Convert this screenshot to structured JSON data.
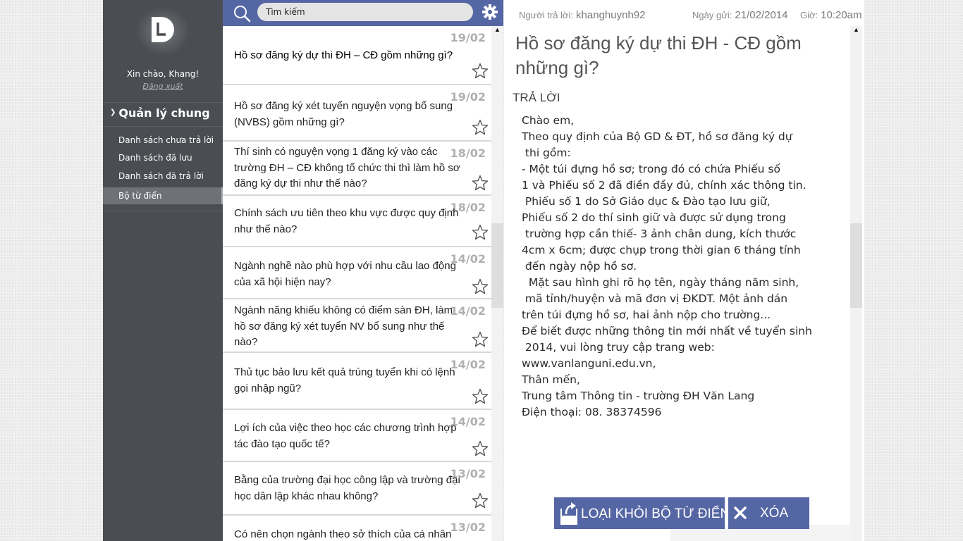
{
  "sidebar": {
    "greeting": "Xin chào, Khang!",
    "logout": "Đăng xuất",
    "section": "Quản lý chung",
    "items": [
      {
        "label": "Danh sách chưa trả lời"
      },
      {
        "label": "Danh sách đã lưu"
      },
      {
        "label": "Danh sách đã trả lời"
      },
      {
        "label": "Bộ từ điển",
        "active": true
      }
    ]
  },
  "search": {
    "value": "Tìm kiếm"
  },
  "questions": [
    {
      "date": "19/02",
      "text": "Hồ sơ đăng ký dự thi ĐH – CĐ gồm những gì?",
      "selected": true
    },
    {
      "date": "19/02",
      "text": "Hồ sơ đăng ký xét tuyển nguyện vọng bổ sung (NVBS) gồm những gì?"
    },
    {
      "date": "18/02",
      "text": "Thí sinh có nguyện vọng 1 đăng ký vào các trường ĐH – CĐ không tổ chức thi thì làm hồ sơ đăng ký dự thi như thế nào?"
    },
    {
      "date": "18/02",
      "text": "Chính sách ưu tiên theo khu vực được quy định như thế nào?"
    },
    {
      "date": "14/02",
      "text": "Ngành nghề nào phù hợp với nhu cầu lao động của xã hội hiện nay?"
    },
    {
      "date": "14/02",
      "text": "Ngành năng khiếu không có điểm sàn ĐH, làm hồ sơ đăng ký xét tuyển NV bổ sung như thế nào?"
    },
    {
      "date": "14/02",
      "text": "Thủ tục bảo lưu kết quả trúng tuyển khi có lệnh gọi nhập ngũ?"
    },
    {
      "date": "14/02",
      "text": "Lợi ích của việc theo học các chương trình hợp tác đào tạo quốc tế?"
    },
    {
      "date": "13/02",
      "text": "Bằng của trường đại học công lập và trường đại học dân lập khác nhau không?"
    },
    {
      "date": "13/02",
      "text": "Có nên chọn ngành theo sở thích của cá nhân"
    }
  ],
  "detail": {
    "responder_label": "Người trả lời:",
    "responder": "khanghuynh92",
    "date_label": "Ngày gửi:",
    "date": "21/02/2014",
    "time_label": "Giờ:",
    "time": "10:20am",
    "title": "Hồ sơ đăng ký dự thi ĐH - CĐ gồm những gì?",
    "answer_label": "TRẢ LỜI",
    "answer_lines": [
      "Chào em,",
      "Theo quy định của Bộ GD & ĐT, hồ sơ đăng ký dự",
      " thi gồm:",
      "- Một túi đựng hồ sơ; trong đó có chứa Phiếu số",
      "1 và Phiếu số 2 đã điền đầy đủ, chính xác thông tin.",
      " Phiếu số 1 do Sở Giáo dục & Đào tạo lưu giữ,",
      "Phiếu số 2 do thí sinh giữ và được sử dụng trong",
      " trường hợp cần thiế- 3 ảnh chân dung, kích thước",
      "4cm x 6cm; được chụp trong thời gian 6 tháng tính",
      " đến ngày nộp hồ sơ.",
      "  Mặt sau hình ghi rõ họ tên, ngày tháng năm sinh,",
      " mã tỉnh/huyện và mã đơn vị ĐKDT. Một ảnh dán",
      "trên túi đựng hồ sơ, hai ảnh nộp cho trường...",
      "Để biết được những thông tin mới nhất về tuyển sinh",
      " 2014, vui lòng truy cập trang web:",
      "www.vanlanguni.edu.vn,",
      "Thân mến,",
      "Trung tâm Thông tin - trường ĐH Văn Lang",
      "Điện thoại: 08. 38374596"
    ]
  },
  "actions": {
    "remove_label": "LOẠI KHỎI BỘ TỪ ĐIỂN",
    "delete_label": "XÓA"
  },
  "colors": {
    "sidebar": "#4a4d52",
    "accent": "#5566a5",
    "date_gray": "#b0b0b0"
  }
}
